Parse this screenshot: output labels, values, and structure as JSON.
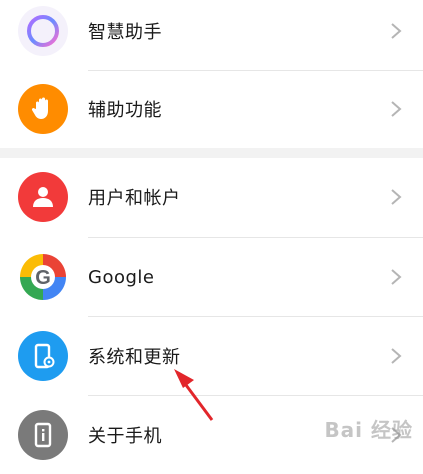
{
  "sections": [
    {
      "items": [
        {
          "label": "智慧助手",
          "icon": "assistant-ring-icon"
        },
        {
          "label": "辅助功能",
          "icon": "hand-icon"
        }
      ]
    },
    {
      "items": [
        {
          "label": "用户和帐户",
          "icon": "user-icon"
        },
        {
          "label": "Google",
          "icon": "google-g-icon"
        },
        {
          "label": "系统和更新",
          "icon": "phone-settings-icon"
        },
        {
          "label": "关于手机",
          "icon": "phone-info-icon"
        }
      ]
    }
  ],
  "watermark": {
    "text": "Bai 经验"
  },
  "colors": {
    "hand": "#ff8c00",
    "user": "#f23a3a",
    "system": "#1e9cf0",
    "about": "#7a7a7a",
    "arrow": "#e2262b"
  }
}
